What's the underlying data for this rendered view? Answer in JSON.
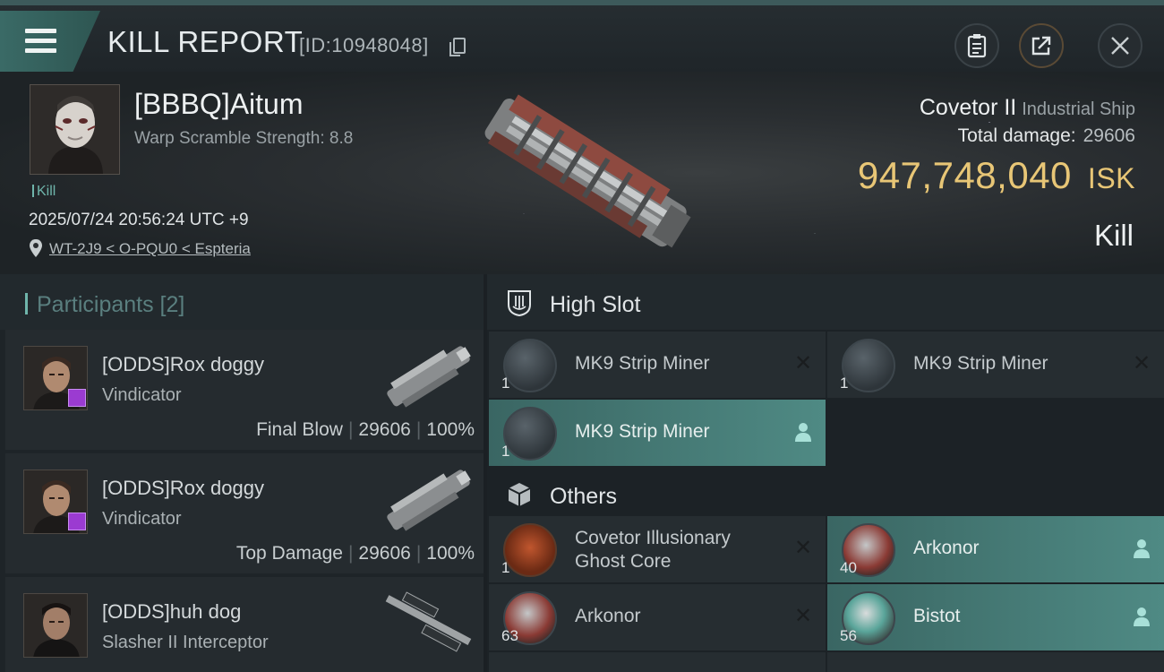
{
  "header": {
    "title": "KILL REPORT",
    "report_id": "[ID:10948048]"
  },
  "victim": {
    "name": "[BBBQ]Aitum",
    "stat_line": "Warp Scramble Strength: 8.8",
    "tag": "Kill",
    "datetime": "2025/07/24 20:56:24 UTC +9",
    "location": "WT-2J9 < O-PQU0 < Espteria",
    "ship_name": "Covetor II",
    "ship_class": "Industrial Ship",
    "total_damage_label": "Total damage:",
    "total_damage": "29606",
    "isk_value": "947,748,040",
    "isk_unit": "ISK",
    "result": "Kill"
  },
  "participants": {
    "title": "Participants [2]",
    "rows": [
      {
        "name": "[ODDS]Rox doggy",
        "ship": "Vindicator",
        "role": "Final Blow",
        "damage": "29606",
        "percent": "100%"
      },
      {
        "name": "[ODDS]Rox doggy",
        "ship": "Vindicator",
        "role": "Top Damage",
        "damage": "29606",
        "percent": "100%"
      },
      {
        "name": "[ODDS]huh dog",
        "ship": "Slasher II Interceptor"
      }
    ]
  },
  "fitting": {
    "high_slot_label": "High Slot",
    "others_label": "Others",
    "high_slot": [
      {
        "name": "MK9 Strip Miner",
        "qty": "1",
        "status": "destroyed"
      },
      {
        "name": "MK9 Strip Miner",
        "qty": "1",
        "status": "destroyed"
      },
      {
        "name": "MK9 Strip Miner",
        "qty": "1",
        "status": "dropped"
      }
    ],
    "others": [
      {
        "name_line1": "Covetor Illusionary",
        "name_line2": "Ghost Core",
        "qty": "1",
        "status": "destroyed"
      },
      {
        "name": "Arkonor",
        "qty": "40",
        "status": "dropped"
      },
      {
        "name": "Arkonor",
        "qty": "63",
        "status": "destroyed"
      },
      {
        "name": "Bistot",
        "qty": "56",
        "status": "dropped"
      }
    ]
  },
  "colors": {
    "accent_teal": "#6fb5ab",
    "isk_gold": "#e8c676",
    "drop_highlight": "#4f8a84",
    "badge_purple": "#9b3bd1"
  },
  "icons": {
    "menu": "hamburger-icon",
    "copy": "copy-icon",
    "clipboard": "clipboard-icon",
    "share": "share-icon",
    "close": "close-icon",
    "location": "location-pin-icon",
    "high_slot": "high-slot-icon",
    "others": "cube-icon",
    "destroyed": "x-icon",
    "dropped": "person-icon"
  }
}
